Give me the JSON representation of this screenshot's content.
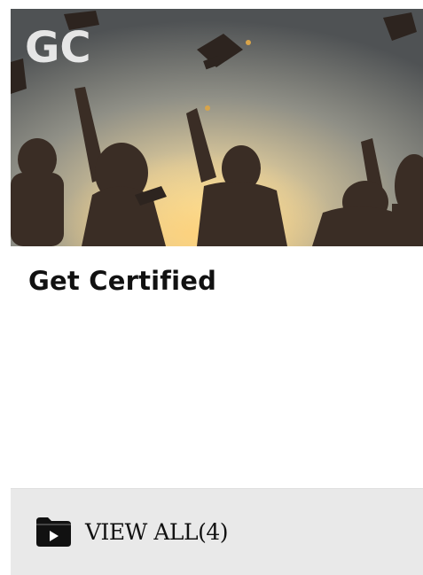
{
  "card": {
    "title": "Get Certified",
    "logo_text": "GC",
    "hero_image": "graduates-tossing-caps-silhouette",
    "footer": {
      "icon": "video-folder-icon",
      "view_all_label": "VIEW ALL(4)"
    }
  },
  "colors": {
    "title": "#111111",
    "footer_background": "#e9e9e9",
    "logo": "#ffffff"
  }
}
